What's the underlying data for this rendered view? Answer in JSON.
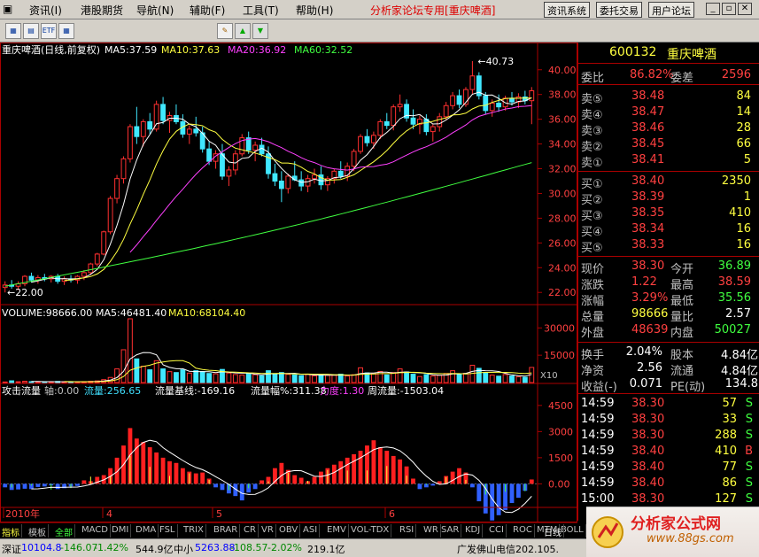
{
  "menu": {
    "items": [
      "资讯(I)",
      "港股期货",
      "导航(N)",
      "辅助(F)",
      "工具(T)",
      "帮助(H)"
    ],
    "forum": "分析家论坛专用",
    "stock_box": "[重庆啤酒]",
    "btns": [
      "资讯系统",
      "委托交易",
      "用户论坛"
    ]
  },
  "toolbar": {
    "icons": [
      "chart-icon",
      "calc-icon",
      "etf-icon",
      "grid-icon",
      "pencil-icon",
      "arrow-up-icon",
      "arrow-down-icon"
    ]
  },
  "chart_data": [
    {
      "type": "candlestick",
      "title": "重庆啤酒(日线,前复权)",
      "ma_labels": [
        {
          "name": "MA5",
          "value": "37.59",
          "color": "#ffffff"
        },
        {
          "name": "MA10",
          "value": "37.63",
          "color": "#ffff40"
        },
        {
          "name": "MA20",
          "value": "36.92",
          "color": "#ff40ff"
        },
        {
          "name": "MA60",
          "value": "32.52",
          "color": "#40ff40"
        }
      ],
      "ylim": [
        21.3,
        41.2
      ],
      "yticks": [
        "40.00",
        "38.00",
        "36.00",
        "34.00",
        "32.00",
        "30.00",
        "28.00",
        "26.00",
        "24.00",
        "22.00"
      ],
      "high_mark": "40.73",
      "low_mark": "22.00",
      "x_labels": [
        "2010年",
        "4",
        "5",
        "6"
      ],
      "ohlc": [
        [
          22.4,
          22.9,
          22.0,
          22.6
        ],
        [
          22.6,
          23.0,
          22.3,
          22.5
        ],
        [
          22.5,
          22.9,
          22.2,
          22.7
        ],
        [
          22.7,
          23.4,
          22.5,
          23.3
        ],
        [
          23.3,
          23.6,
          22.8,
          23.0
        ],
        [
          23.0,
          23.4,
          22.7,
          23.2
        ],
        [
          23.2,
          23.5,
          22.9,
          23.1
        ],
        [
          23.1,
          23.4,
          22.8,
          23.3
        ],
        [
          23.3,
          23.5,
          22.7,
          22.9
        ],
        [
          22.9,
          23.3,
          22.6,
          23.1
        ],
        [
          23.1,
          23.4,
          22.8,
          23.0
        ],
        [
          23.0,
          23.4,
          22.7,
          23.3
        ],
        [
          23.3,
          23.8,
          23.0,
          23.6
        ],
        [
          23.6,
          24.4,
          23.4,
          24.3
        ],
        [
          24.3,
          25.2,
          24.1,
          25.1
        ],
        [
          25.1,
          27.0,
          25.0,
          26.9
        ],
        [
          26.9,
          29.8,
          26.7,
          29.6
        ],
        [
          29.6,
          31.5,
          29.2,
          31.2
        ],
        [
          31.2,
          33.0,
          30.8,
          32.8
        ],
        [
          32.8,
          35.6,
          32.5,
          35.4
        ],
        [
          35.4,
          37.0,
          34.0,
          34.6
        ],
        [
          34.6,
          36.0,
          33.8,
          35.8
        ],
        [
          35.8,
          36.5,
          34.8,
          35.2
        ],
        [
          35.2,
          37.5,
          35.0,
          37.2
        ],
        [
          37.2,
          37.8,
          35.6,
          35.9
        ],
        [
          35.9,
          36.6,
          34.9,
          36.3
        ],
        [
          36.3,
          37.2,
          35.6,
          35.8
        ],
        [
          35.8,
          36.4,
          34.5,
          34.8
        ],
        [
          34.8,
          35.5,
          34.0,
          35.2
        ],
        [
          35.2,
          36.2,
          34.6,
          34.9
        ],
        [
          34.9,
          35.4,
          33.3,
          33.6
        ],
        [
          33.6,
          34.2,
          32.3,
          32.6
        ],
        [
          32.6,
          33.5,
          32.0,
          33.2
        ],
        [
          33.2,
          34.0,
          31.1,
          31.4
        ],
        [
          31.4,
          32.2,
          30.6,
          31.9
        ],
        [
          31.9,
          33.5,
          31.5,
          33.2
        ],
        [
          33.2,
          34.8,
          33.0,
          34.5
        ],
        [
          34.5,
          35.0,
          33.2,
          33.5
        ],
        [
          33.5,
          34.2,
          32.6,
          33.9
        ],
        [
          33.9,
          34.5,
          33.0,
          33.2
        ],
        [
          33.2,
          33.8,
          31.2,
          31.6
        ],
        [
          31.6,
          32.4,
          30.6,
          31.0
        ],
        [
          31.0,
          31.8,
          29.3,
          30.4
        ],
        [
          30.4,
          31.6,
          30.0,
          31.4
        ],
        [
          31.4,
          32.6,
          31.0,
          31.1
        ],
        [
          31.1,
          31.8,
          30.2,
          30.6
        ],
        [
          30.6,
          31.5,
          30.1,
          31.2
        ],
        [
          31.2,
          32.0,
          30.8,
          31.5
        ],
        [
          31.5,
          32.2,
          30.3,
          30.7
        ],
        [
          30.7,
          31.4,
          30.2,
          31.2
        ],
        [
          31.2,
          32.0,
          30.8,
          31.8
        ],
        [
          31.8,
          32.6,
          31.2,
          31.4
        ],
        [
          31.4,
          32.5,
          31.0,
          32.2
        ],
        [
          32.2,
          33.6,
          31.8,
          33.4
        ],
        [
          33.4,
          34.8,
          33.2,
          34.6
        ],
        [
          34.6,
          35.2,
          33.8,
          34.1
        ],
        [
          34.1,
          35.0,
          33.6,
          34.7
        ],
        [
          34.7,
          36.0,
          34.4,
          35.8
        ],
        [
          35.8,
          36.5,
          35.2,
          35.5
        ],
        [
          35.5,
          37.2,
          35.1,
          37.0
        ],
        [
          37.0,
          38.0,
          36.6,
          37.2
        ],
        [
          37.2,
          37.6,
          35.8,
          36.1
        ],
        [
          36.1,
          36.8,
          35.2,
          35.6
        ],
        [
          35.6,
          36.3,
          34.8,
          36.0
        ],
        [
          36.0,
          36.4,
          34.7,
          35.0
        ],
        [
          35.0,
          35.6,
          34.2,
          35.4
        ],
        [
          35.4,
          36.5,
          35.0,
          36.2
        ],
        [
          36.2,
          37.4,
          35.9,
          37.1
        ],
        [
          37.1,
          38.2,
          36.8,
          37.9
        ],
        [
          37.9,
          38.4,
          36.9,
          37.2
        ],
        [
          37.2,
          38.6,
          37.0,
          38.4
        ],
        [
          38.4,
          40.7,
          38.0,
          39.5
        ],
        [
          39.5,
          39.8,
          37.6,
          37.9
        ],
        [
          37.9,
          38.2,
          36.4,
          36.7
        ],
        [
          36.7,
          37.6,
          36.2,
          37.3
        ],
        [
          37.3,
          38.0,
          36.6,
          37.0
        ],
        [
          37.0,
          37.9,
          36.7,
          37.7
        ],
        [
          37.7,
          38.2,
          37.1,
          37.4
        ],
        [
          37.4,
          38.1,
          36.9,
          37.8
        ],
        [
          37.8,
          38.3,
          37.2,
          37.5
        ],
        [
          37.5,
          38.6,
          35.6,
          38.3
        ]
      ]
    },
    {
      "type": "bar",
      "title": "VOLUME:98666.00",
      "ma_labels": [
        {
          "name": "MA5",
          "value": "46481.40",
          "color": "#ffffff"
        },
        {
          "name": "MA10",
          "value": "68104.40",
          "color": "#ffff40"
        }
      ],
      "yticks": [
        "30000",
        "15000"
      ],
      "unit": "X10",
      "volume": [
        300,
        950,
        450,
        720,
        500,
        420,
        380,
        350,
        620,
        440,
        360,
        340,
        500,
        700,
        900,
        1600,
        2800,
        7500,
        18000,
        35000,
        13000,
        9000,
        7000,
        12000,
        7500,
        6000,
        5500,
        7000,
        5200,
        6500,
        6000,
        5000,
        4800,
        7200,
        5200,
        4400,
        4100,
        5000,
        4300,
        3700,
        6500,
        4800,
        5500,
        4500,
        4200,
        3800,
        4500,
        3700,
        4300,
        3900,
        4000,
        4600,
        3600,
        4300,
        8100,
        5300,
        4900,
        6100,
        4200,
        5500,
        7500,
        5800,
        4600,
        3300,
        4400,
        3600,
        4000,
        5000,
        6500,
        4600,
        5100,
        9500,
        7800,
        5500,
        4100,
        3500,
        4400,
        3600,
        3200,
        2900,
        8300
      ]
    },
    {
      "type": "bar",
      "title": "攻击流量",
      "labels": [
        {
          "name": "轴",
          "value": "0.00",
          "color": "#c0c0c0"
        },
        {
          "name": "流量",
          "value": "256.65",
          "color": "#40e0ff"
        },
        {
          "name": "流量基线",
          "value": "-169.16",
          "color": "#ffffff"
        },
        {
          "name": "流量幅%",
          "value": "311.38",
          "color": "#ffffff"
        },
        {
          "name": "力度",
          "value": "1.30",
          "color": "#ff40ff"
        },
        {
          "name": "周流量",
          "value": "-1503.04",
          "color": "#ffffff"
        }
      ],
      "ylim": [
        -1200,
        5000
      ],
      "yticks": [
        "4500",
        "3000",
        "1500",
        "0.00"
      ],
      "flow": [
        -200,
        -350,
        -320,
        -280,
        -300,
        -180,
        -150,
        -90,
        -300,
        -250,
        -150,
        -120,
        200,
        150,
        400,
        500,
        900,
        1500,
        2200,
        3200,
        2600,
        2400,
        2100,
        1800,
        1500,
        1300,
        1200,
        900,
        700,
        600,
        650,
        300,
        -200,
        -350,
        -550,
        -700,
        -950,
        -500,
        -300,
        200,
        400,
        900,
        1200,
        800,
        500,
        350,
        150,
        400,
        700,
        900,
        1100,
        1300,
        1500,
        1700,
        1900,
        2200,
        2500,
        2100,
        1900,
        1600,
        1400,
        1000,
        300,
        -300,
        -200,
        -100,
        150,
        450,
        700,
        900,
        650,
        -200,
        -1000,
        -1700,
        -2100,
        -1800,
        -1500,
        -1100,
        -800,
        -400,
        250
      ]
    }
  ],
  "quote": {
    "code": "600132",
    "name": "重庆啤酒",
    "weibi_label": "委比",
    "weibi": "86.82%",
    "weicha_label": "委差",
    "weicha": "2596",
    "sells": [
      {
        "label": "卖⑤",
        "price": "38.48",
        "vol": "84"
      },
      {
        "label": "卖④",
        "price": "38.47",
        "vol": "14"
      },
      {
        "label": "卖③",
        "price": "38.46",
        "vol": "28"
      },
      {
        "label": "卖②",
        "price": "38.45",
        "vol": "66"
      },
      {
        "label": "卖①",
        "price": "38.41",
        "vol": "5"
      }
    ],
    "buys": [
      {
        "label": "买①",
        "price": "38.40",
        "vol": "2350"
      },
      {
        "label": "买②",
        "price": "38.39",
        "vol": "1"
      },
      {
        "label": "买③",
        "price": "38.35",
        "vol": "410"
      },
      {
        "label": "买④",
        "price": "38.34",
        "vol": "16"
      },
      {
        "label": "买⑤",
        "price": "38.33",
        "vol": "16"
      }
    ],
    "stats": [
      {
        "l1": "现价",
        "v1": "38.30",
        "c1": "red",
        "l2": "今开",
        "v2": "36.89",
        "c2": "grn"
      },
      {
        "l1": "涨跌",
        "v1": "1.22",
        "c1": "red",
        "l2": "最高",
        "v2": "38.59",
        "c2": "red"
      },
      {
        "l1": "涨幅",
        "v1": "3.29%",
        "c1": "red",
        "l2": "最低",
        "v2": "35.56",
        "c2": "grn"
      },
      {
        "l1": "总量",
        "v1": "98666",
        "c1": "ylw",
        "l2": "量比",
        "v2": "2.57",
        "c2": "wht"
      },
      {
        "l1": "外盘",
        "v1": "48639",
        "c1": "red",
        "l2": "内盘",
        "v2": "50027",
        "c2": "grn"
      }
    ],
    "stats2": [
      {
        "l1": "换手",
        "v1": "2.04%",
        "l2": "股本",
        "v2": "4.84亿"
      },
      {
        "l1": "净资",
        "v1": "2.56",
        "l2": "流通",
        "v2": "4.84亿"
      },
      {
        "l1": "收益(-)",
        "v1": "0.071",
        "l2": "PE(动)",
        "v2": "134.8"
      }
    ],
    "ticks": [
      {
        "t": "14:59",
        "p": "38.30",
        "v": "57",
        "s": "S"
      },
      {
        "t": "14:59",
        "p": "38.30",
        "v": "33",
        "s": "S"
      },
      {
        "t": "14:59",
        "p": "38.30",
        "v": "288",
        "s": "S"
      },
      {
        "t": "14:59",
        "p": "38.40",
        "v": "410",
        "s": "B"
      },
      {
        "t": "14:59",
        "p": "38.40",
        "v": "77",
        "s": "S"
      },
      {
        "t": "14:59",
        "p": "38.40",
        "v": "86",
        "s": "S"
      },
      {
        "t": "15:00",
        "p": "38.30",
        "v": "127",
        "s": "S"
      }
    ]
  },
  "tabs": [
    "指标",
    "模板",
    "全部",
    "MACD",
    "DMI",
    "DMA",
    "FSL",
    "TRIX",
    "BRAR",
    "CR",
    "VR",
    "OBV",
    "ASI",
    "EMV",
    "VOL-TDX",
    "RSI",
    "WR",
    "SAR",
    "KDJ",
    "CCI",
    "ROC",
    "MTM",
    "BOLL",
    "日线"
  ],
  "status": {
    "sz_label": "深证",
    "sz": "10104.8",
    "sz_chg": "-146.07",
    "sz_pct": "-1.42%",
    "sz_amt": "544.9亿",
    "zx_label": "中小",
    "zx": "5263.88",
    "zx_chg": "-108.57",
    "zx_pct": "-2.02%",
    "zx_amt": "219.1亿",
    "news": "广发佛山电信202.105.",
    "logo": "分析家公式网",
    "logo_url": "www.88gs.com"
  }
}
